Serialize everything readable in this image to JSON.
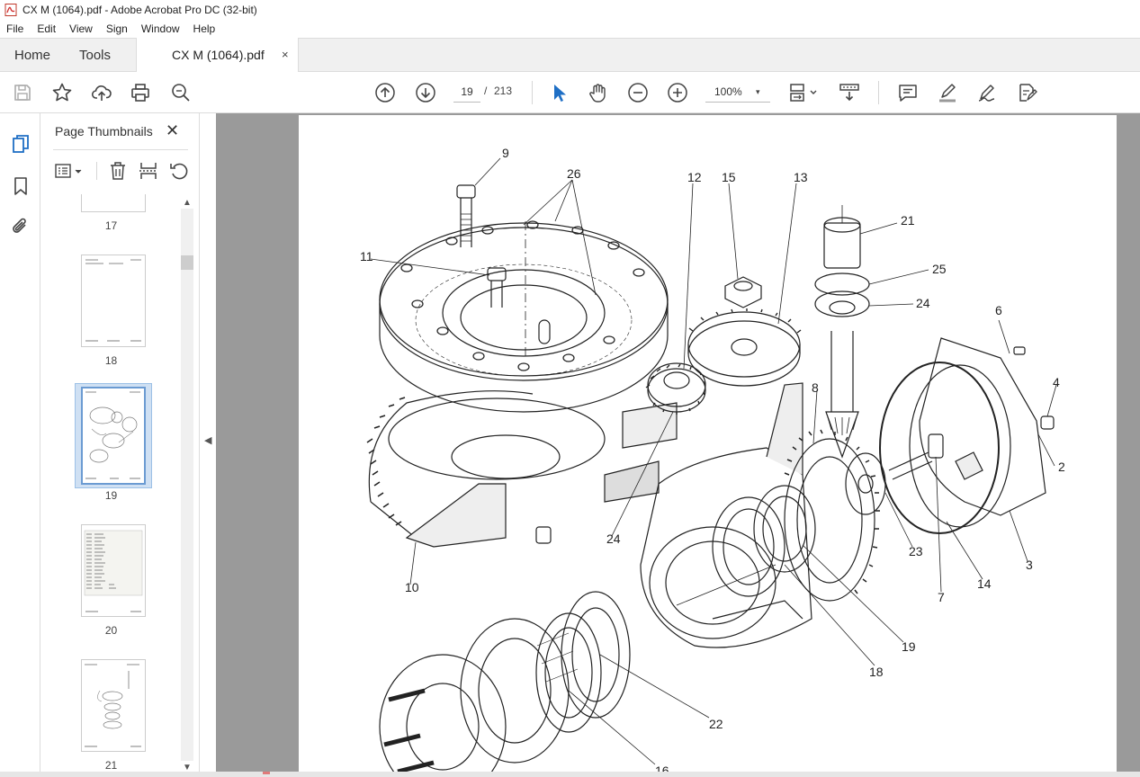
{
  "window": {
    "title": "CX M (1064).pdf - Adobe Acrobat Pro DC (32-bit)",
    "app_icon": "acrobat-pdf-icon"
  },
  "menu": [
    "File",
    "Edit",
    "View",
    "Sign",
    "Window",
    "Help"
  ],
  "tabs": {
    "home": "Home",
    "tools": "Tools",
    "document": "CX M (1064).pdf",
    "close": "×"
  },
  "toolbar": {
    "icons_left": [
      "save-icon",
      "star-icon",
      "upload-cloud-icon",
      "print-icon",
      "zoom-search-icon"
    ],
    "current_page": "19",
    "page_separator": "/",
    "total_pages": "213",
    "zoom": "100%",
    "zoom_caret": "▾",
    "icons_center": [
      "prev-page-icon",
      "next-page-icon",
      "select-cursor-icon",
      "hand-icon",
      "zoom-out-icon",
      "zoom-in-icon"
    ],
    "icons_right": [
      "fit-page-icon",
      "scroll-mode-icon",
      "comment-icon",
      "highlight-pen-icon",
      "sign-icon",
      "export-edit-icon"
    ]
  },
  "left_rail": {
    "icons": [
      "page-thumbnails-icon",
      "bookmark-icon",
      "attachment-icon"
    ]
  },
  "thumbnail_panel": {
    "title": "Page Thumbnails",
    "close": "✕",
    "tools": [
      "options-menu-icon",
      "delete-icon",
      "insert-page-icon",
      "rotate-icon"
    ],
    "pages": [
      {
        "label": "17"
      },
      {
        "label": "18"
      },
      {
        "label": "19",
        "selected": true
      },
      {
        "label": "20"
      },
      {
        "label": "21"
      }
    ],
    "scroll_up": "▲",
    "scroll_down": "▼",
    "collapse": "◀"
  },
  "document": {
    "callouts": [
      "9",
      "26",
      "12",
      "15",
      "13",
      "21",
      "25",
      "24",
      "11",
      "6",
      "4",
      "8",
      "2",
      "10",
      "24",
      "23",
      "3",
      "7",
      "14",
      "19",
      "18",
      "22",
      "16"
    ]
  }
}
